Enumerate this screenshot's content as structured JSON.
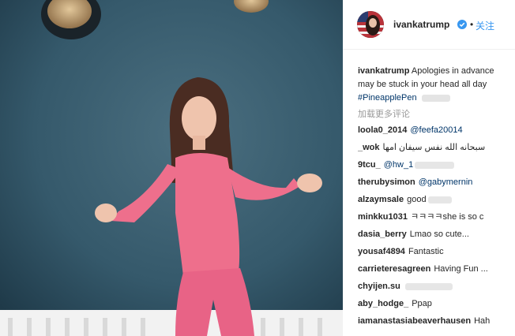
{
  "post": {
    "username": "ivankatrump",
    "dot": "•",
    "follow_label": "关注"
  },
  "caption": {
    "username": "ivankatrump",
    "text_line1": "Apologies in advance",
    "text_line2": "may be stuck in your head all day",
    "hashtag": "#PineapplePen"
  },
  "load_more_label": "加载更多评论",
  "comments": [
    {
      "user": "loola0_2014",
      "text": "@feefa20014",
      "mention": true
    },
    {
      "user": "_wok",
      "text": "سبحانه الله نفس سيفان امها",
      "mention": false
    },
    {
      "user": "9tcu_",
      "text": "@hw_1",
      "mention": true
    },
    {
      "user": "therubysimon",
      "text": "@gabymernin",
      "mention": true
    },
    {
      "user": "alzaymsale",
      "text": "good",
      "mention": false
    },
    {
      "user": "minkku1031",
      "text": "ㅋㅋㅋㅋshe is so c",
      "mention": false
    },
    {
      "user": "dasia_berry",
      "text": "Lmao so cute...",
      "mention": false
    },
    {
      "user": "yousaf4894",
      "text": "Fantastic",
      "mention": false
    },
    {
      "user": "carrieteresagreen",
      "text": "Having Fun ...",
      "mention": false
    },
    {
      "user": "chyijen.su",
      "text": "",
      "mention": false
    },
    {
      "user": "aby_hodge_",
      "text": "Ppap",
      "mention": false
    },
    {
      "user": "iamanastasiabeaverhausen",
      "text": "Hah",
      "mention": false
    }
  ],
  "colors": {
    "link": "#3897f0",
    "mention": "#003569",
    "wall": "#2f5364",
    "pajamas": "#ee6f8c"
  },
  "icons": {
    "verified": "verified-badge-icon"
  }
}
